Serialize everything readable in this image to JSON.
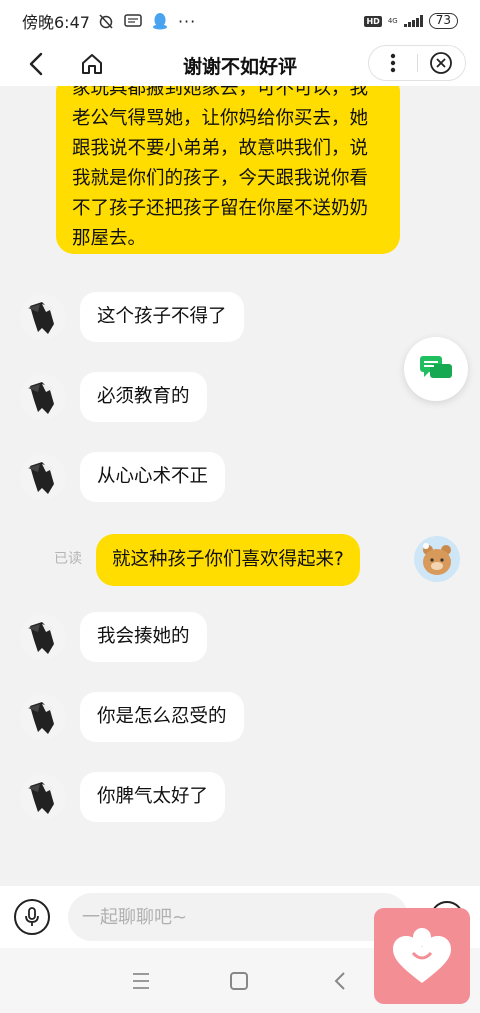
{
  "status_bar": {
    "time": "傍晚6:47",
    "network": "4G",
    "battery": "73",
    "hd_label": "HD"
  },
  "header": {
    "title": "谢谢不如好评"
  },
  "messages": [
    {
      "side": "right",
      "text": "家玩具都搬到她家去，可不可以，我老公气得骂她，让你妈给你买去，她跟我说不要小弟弟，故意哄我们，说我就是你们的孩子，今天跟我说你看不了孩子还把孩子留在你屋不送奶奶那屋去。"
    },
    {
      "side": "left",
      "text": "这个孩子不得了"
    },
    {
      "side": "left",
      "text": "必须教育的"
    },
    {
      "side": "left",
      "text": "从心心术不正"
    },
    {
      "side": "right",
      "text": "就这种孩子你们喜欢得起来?",
      "status": "已读"
    },
    {
      "side": "left",
      "text": "我会揍她的"
    },
    {
      "side": "left",
      "text": "你是怎么忍受的"
    },
    {
      "side": "left",
      "text": "你脾气太好了"
    }
  ],
  "input": {
    "placeholder": "一起聊聊吧~"
  },
  "colors": {
    "my_bubble": "#ffdd00",
    "their_bubble": "#ffffff",
    "chat_bg": "#f2f2f2",
    "float_icon": "#1fbf5f",
    "heart_widget": "#f38e95"
  },
  "icons": {
    "float_button": "chat-bubbles-icon",
    "widget": "heart-icon"
  }
}
